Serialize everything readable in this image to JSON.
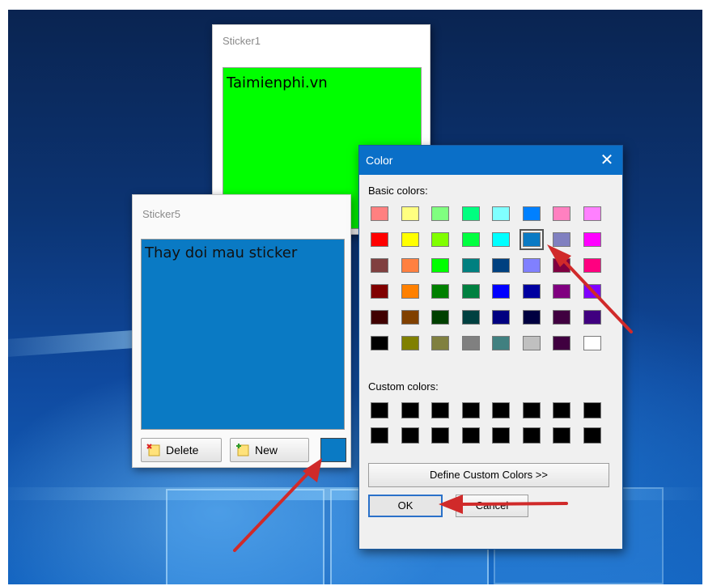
{
  "sticker1": {
    "title": "Sticker1",
    "text": "Taimienphi.vn",
    "bg": "#00ff00"
  },
  "sticker5": {
    "title": "Sticker5",
    "text": "Thay doi mau sticker",
    "bg": "#0a7ac4",
    "delete_label": "Delete",
    "new_label": "New",
    "swatch_color": "#0a7ac4"
  },
  "color_dialog": {
    "title": "Color",
    "close_glyph": "✕",
    "basic_label": "Basic colors:",
    "custom_label": "Custom colors:",
    "define_label": "Define Custom Colors >>",
    "ok_label": "OK",
    "cancel_label": "Cancel",
    "selected": {
      "row": 1,
      "col": 5
    },
    "basic_colors": [
      [
        "#ff8080",
        "#ffff80",
        "#80ff80",
        "#00ff80",
        "#80ffff",
        "#0080ff",
        "#ff80c0",
        "#ff80ff"
      ],
      [
        "#ff0000",
        "#ffff00",
        "#80ff00",
        "#00ff40",
        "#00ffff",
        "#0a7ac4",
        "#8080c0",
        "#ff00ff"
      ],
      [
        "#804040",
        "#ff8040",
        "#00ff00",
        "#008080",
        "#004080",
        "#8080ff",
        "#800040",
        "#ff0080"
      ],
      [
        "#800000",
        "#ff8000",
        "#008000",
        "#008040",
        "#0000ff",
        "#0000a0",
        "#800080",
        "#8000ff"
      ],
      [
        "#400000",
        "#804000",
        "#004000",
        "#004040",
        "#000080",
        "#000040",
        "#400040",
        "#400080"
      ],
      [
        "#000000",
        "#808000",
        "#808040",
        "#808080",
        "#408080",
        "#c0c0c0",
        "#400040",
        "#ffffff"
      ]
    ],
    "custom_colors": [
      [
        "#000000",
        "#000000",
        "#000000",
        "#000000",
        "#000000",
        "#000000",
        "#000000",
        "#000000"
      ],
      [
        "#000000",
        "#000000",
        "#000000",
        "#000000",
        "#000000",
        "#000000",
        "#000000",
        "#000000"
      ]
    ]
  },
  "annotation_color": "#d02a2a"
}
